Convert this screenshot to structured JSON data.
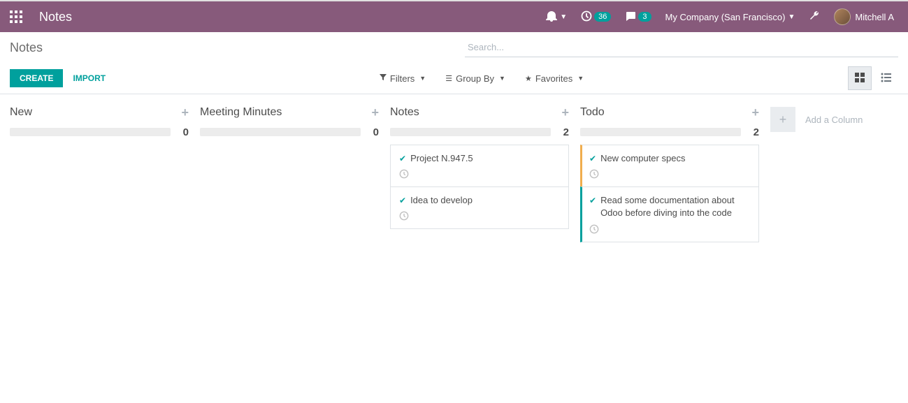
{
  "navbar": {
    "app_title": "Notes",
    "activity_badge": "36",
    "discuss_badge": "3",
    "company": "My Company (San Francisco)",
    "user": "Mitchell A"
  },
  "cp": {
    "breadcrumb": "Notes",
    "search_placeholder": "Search...",
    "create_label": "CREATE",
    "import_label": "IMPORT",
    "filters_label": "Filters",
    "groupby_label": "Group By",
    "favorites_label": "Favorites"
  },
  "columns": [
    {
      "title": "New",
      "count": "0",
      "cards": []
    },
    {
      "title": "Meeting Minutes",
      "count": "0",
      "cards": []
    },
    {
      "title": "Notes",
      "count": "2",
      "cards": [
        {
          "title": "Project N.947.5",
          "border": ""
        },
        {
          "title": "Idea to develop",
          "border": ""
        }
      ]
    },
    {
      "title": "Todo",
      "count": "2",
      "cards": [
        {
          "title": "New computer specs",
          "border": "yellow"
        },
        {
          "title": "Read some documentation about Odoo before diving into the code",
          "border": "teal"
        }
      ]
    }
  ],
  "add_column_label": "Add a Column"
}
